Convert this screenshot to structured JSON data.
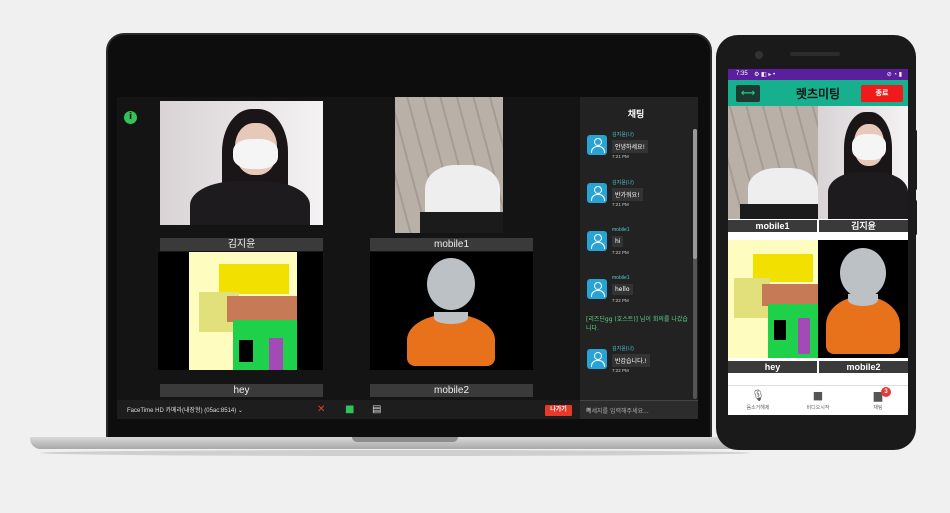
{
  "laptop": {
    "participants": [
      "김지윤",
      "mobile1",
      "hey",
      "mobile2"
    ],
    "camera_select": "FaceTime HD 카메라(내장형) (05ac:8514)  ⌄",
    "leave_label": "나가기",
    "chat": {
      "title": "채팅",
      "messages": [
        {
          "name": "김지윤(나)",
          "text": "안녕하세요!",
          "time": "7:21 PM"
        },
        {
          "name": "김지윤(나)",
          "text": "반가워요!",
          "time": "7:21 PM"
        },
        {
          "name": "mobile1",
          "text": "hi",
          "time": "7:22 PM"
        },
        {
          "name": "mobile1",
          "text": "hello",
          "time": "7:22 PM"
        },
        {
          "name": "김지윤(나)",
          "text": "반갑습니다.!",
          "time": "7:22 PM"
        }
      ],
      "system_message": "[리즈딘gg (호스트)] 님이 회의를 나갔습니다.",
      "input_placeholder": "메세지를 입력해주세요..."
    }
  },
  "phone": {
    "status_time": "7:35",
    "status_icons": "⚙ ◧ ▸ •",
    "status_right": "⊘ ◔ ▮",
    "back_icon": "⟷",
    "title": "렛츠미팅",
    "end_label": "종료",
    "participants": [
      "mobile1",
      "김지윤",
      "hey",
      "mobile2"
    ],
    "nav": [
      {
        "label": "음소거해제",
        "icon": "mic-off-icon"
      },
      {
        "label": "비디오시작",
        "icon": "video-icon"
      },
      {
        "label": "채팅",
        "icon": "chat-icon",
        "badge": "3"
      }
    ]
  },
  "colors": {
    "accent": "#16b08f",
    "leave": "#e53a2a",
    "end": "#f01a1a",
    "status_bar": "#5b1f9e",
    "chat_name": "#4ec5d6",
    "system": "#5fd68b"
  }
}
